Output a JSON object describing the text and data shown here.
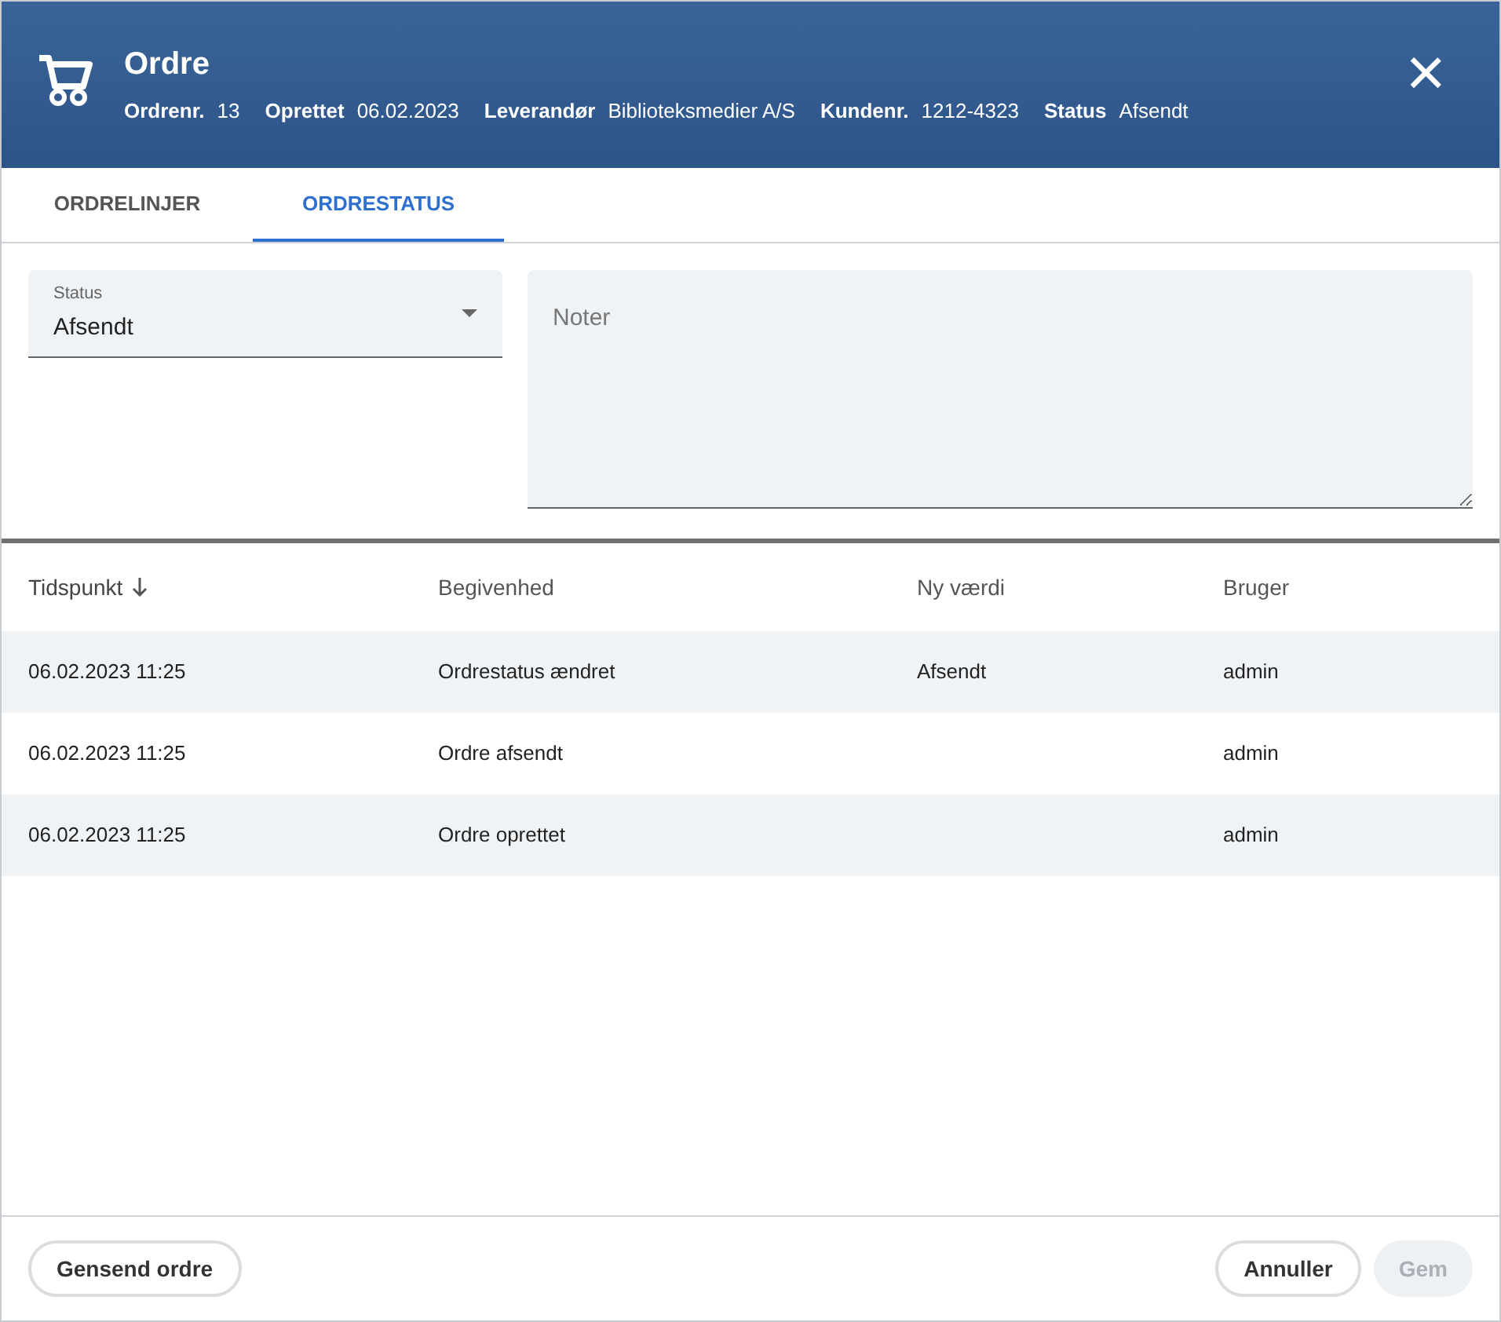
{
  "header": {
    "title": "Ordre",
    "close": "×",
    "meta": [
      {
        "label": "Ordrenr.",
        "value": "13"
      },
      {
        "label": "Oprettet",
        "value": "06.02.2023"
      },
      {
        "label": "Leverandør",
        "value": "Biblioteksmedier A/S"
      },
      {
        "label": "Kundenr.",
        "value": "1212-4323"
      },
      {
        "label": "Status",
        "value": "Afsendt"
      }
    ]
  },
  "tabs": [
    {
      "label": "ORDRELINJER",
      "selected": false
    },
    {
      "label": "ORDRESTATUS",
      "selected": true
    }
  ],
  "status_select": {
    "label": "Status",
    "value": "Afsendt"
  },
  "notes": {
    "placeholder": "Noter"
  },
  "table": {
    "columns": [
      {
        "label": "Tidspunkt",
        "sorted": true
      },
      {
        "label": "Begivenhed",
        "sorted": false
      },
      {
        "label": "Ny værdi",
        "sorted": false
      },
      {
        "label": "Bruger",
        "sorted": false
      }
    ],
    "rows": [
      [
        "06.02.2023 11:25",
        "Ordrestatus ændret",
        "Afsendt",
        "admin"
      ],
      [
        "06.02.2023 11:25",
        "Ordre afsendt",
        "",
        "admin"
      ],
      [
        "06.02.2023 11:25",
        "Ordre oprettet",
        "",
        "admin"
      ]
    ]
  },
  "footer": {
    "left": [
      {
        "label": "Gensend ordre",
        "disabled": false
      }
    ],
    "right": [
      {
        "label": "Annuller",
        "disabled": false
      },
      {
        "label": "Gem",
        "disabled": true
      }
    ]
  }
}
